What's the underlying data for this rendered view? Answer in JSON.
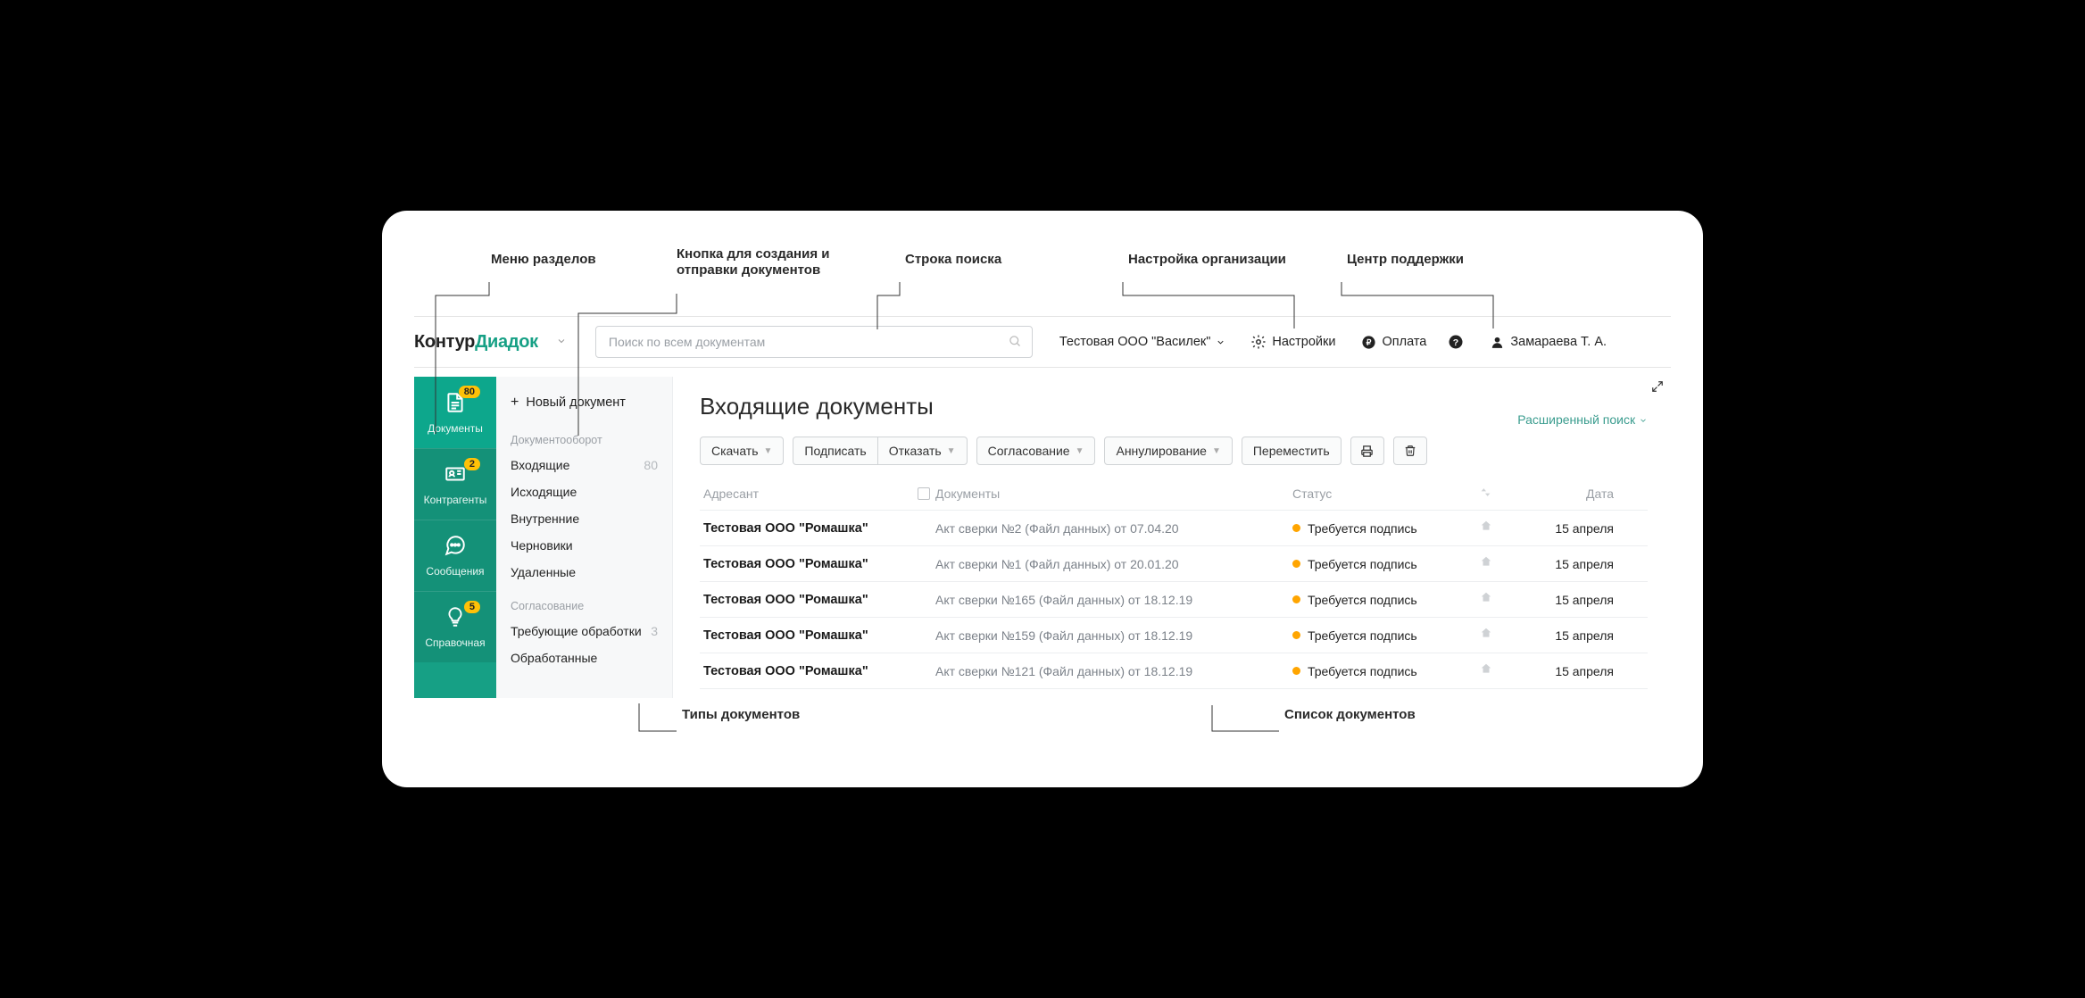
{
  "annotations": {
    "menu": "Меню разделов",
    "new_doc_btn": "Кнопка для создания и отправки документов",
    "search_bar": "Строка поиска",
    "org_settings": "Настройка организации",
    "support": "Центр поддержки",
    "doc_types": "Типы документов",
    "doc_list": "Список документов"
  },
  "logo": {
    "part1": "Контур",
    "part2": "Диадок"
  },
  "search": {
    "placeholder": "Поиск по всем документам"
  },
  "header": {
    "org": "Тестовая ООО \"Василек\"",
    "settings": "Настройки",
    "payment": "Оплата",
    "user": "Замараева Т. А."
  },
  "rail": [
    {
      "label": "Документы",
      "badge": "80",
      "icon": "doc"
    },
    {
      "label": "Контрагенты",
      "badge": "2",
      "icon": "card"
    },
    {
      "label": "Сообщения",
      "badge": "",
      "icon": "chat"
    },
    {
      "label": "Справочная",
      "badge": "5",
      "icon": "bulb"
    }
  ],
  "sidebar": {
    "new_doc": "Новый документ",
    "section1": "Документооборот",
    "items1": [
      {
        "label": "Входящие",
        "count": "80"
      },
      {
        "label": "Исходящие",
        "count": ""
      },
      {
        "label": "Внутренние",
        "count": ""
      },
      {
        "label": "Черновики",
        "count": ""
      },
      {
        "label": "Удаленные",
        "count": ""
      }
    ],
    "section2": "Согласование",
    "items2": [
      {
        "label": "Требующие обработки",
        "count": "3"
      },
      {
        "label": "Обработанные",
        "count": ""
      }
    ]
  },
  "main": {
    "title": "Входящие документы",
    "adv_search": "Расширенный поиск",
    "toolbar": {
      "download": "Скачать",
      "sign": "Подписать",
      "reject": "Отказать",
      "approve": "Согласование",
      "annul": "Аннулирование",
      "move": "Переместить"
    },
    "columns": {
      "sender": "Адресант",
      "docs": "Документы",
      "status": "Статус",
      "date": "Дата"
    },
    "rows": [
      {
        "sender": "Тестовая ООО \"Ромашка\"",
        "doc": "Акт сверки №2 (Файл данных) от 07.04.20",
        "status": "Требуется подпись",
        "date": "15 апреля"
      },
      {
        "sender": "Тестовая ООО \"Ромашка\"",
        "doc": "Акт сверки №1 (Файл данных) от 20.01.20",
        "status": "Требуется подпись",
        "date": "15 апреля"
      },
      {
        "sender": "Тестовая ООО \"Ромашка\"",
        "doc": "Акт сверки №165 (Файл данных) от 18.12.19",
        "status": "Требуется подпись",
        "date": "15 апреля"
      },
      {
        "sender": "Тестовая ООО \"Ромашка\"",
        "doc": "Акт сверки №159 (Файл данных) от 18.12.19",
        "status": "Требуется подпись",
        "date": "15 апреля"
      },
      {
        "sender": "Тестовая ООО \"Ромашка\"",
        "doc": "Акт сверки №121 (Файл данных) от 18.12.19",
        "status": "Требуется подпись",
        "date": "15 апреля"
      }
    ]
  }
}
